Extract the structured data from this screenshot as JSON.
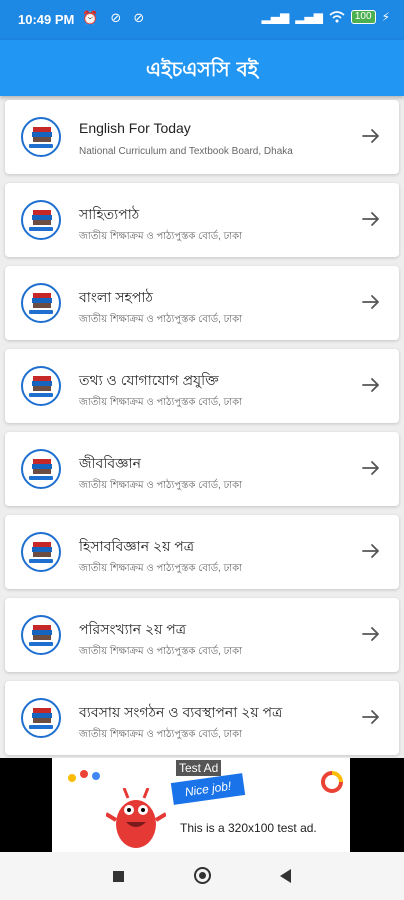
{
  "status_bar": {
    "time": "10:49 PM",
    "left_icons": "⏰ ⊘ ⊘",
    "signal": "▂▄▆",
    "battery": "100"
  },
  "app_bar": {
    "title": "এইচএসসি বই"
  },
  "books": [
    {
      "title": "English For Today",
      "subtitle": "National Curriculum and Textbook Board, Dhaka"
    },
    {
      "title": "সাহিত্যপাঠ",
      "subtitle": "জাতীয় শিক্ষাক্রম ও পাঠ্যপুস্তক বোর্ড, ঢাকা"
    },
    {
      "title": "বাংলা সহপাঠ",
      "subtitle": "জাতীয় শিক্ষাক্রম ও পাঠ্যপুস্তক বোর্ড, ঢাকা"
    },
    {
      "title": "তথ্য ও যোগাযোগ প্রযুক্তি",
      "subtitle": "জাতীয় শিক্ষাক্রম ও পাঠ্যপুস্তক বোর্ড, ঢাকা"
    },
    {
      "title": "জীববিজ্ঞান",
      "subtitle": "জাতীয় শিক্ষাক্রম ও পাঠ্যপুস্তক বোর্ড, ঢাকা"
    },
    {
      "title": "হিসাববিজ্ঞান ২য় পত্র",
      "subtitle": "জাতীয় শিক্ষাক্রম ও পাঠ্যপুস্তক বোর্ড, ঢাকা"
    },
    {
      "title": "পরিসংখ্যান ২য় পত্র",
      "subtitle": "জাতীয় শিক্ষাক্রম ও পাঠ্যপুস্তক বোর্ড, ঢাকা"
    },
    {
      "title": "ব্যবসায় সংগঠন ও ব্যবস্থাপনা ২য় পত্র",
      "subtitle": "জাতীয় শিক্ষাক্রম ও পাঠ্যপুস্তক বোর্ড, ঢাকা"
    }
  ],
  "ad": {
    "label": "Test Ad",
    "badge": "Nice job!",
    "text": "This is a 320x100 test ad."
  },
  "colors": {
    "primary": "#2196f3",
    "status": "#1e88e5"
  }
}
